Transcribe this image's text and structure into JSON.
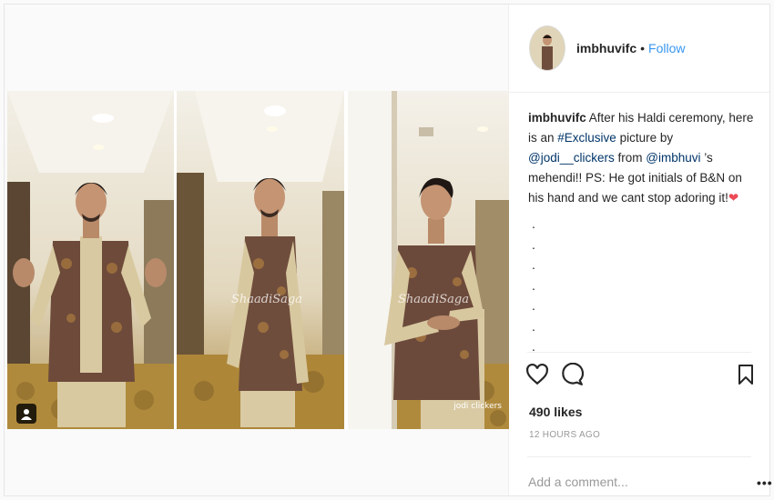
{
  "post": {
    "username": "imbhuvifc",
    "separator": "•",
    "follow_label": "Follow",
    "caption": {
      "username": "imbhuvifc",
      "text_1": " After his Haldi ceremony, here is an ",
      "hashtag": "#Exclusive",
      "text_2": " picture by ",
      "mention_1": "@jodi__clickers",
      "text_3": " from ",
      "mention_2": "@imbhuvi",
      "text_4": " ’s mehendi!! PS: He got initials of B&N on his hand and we cant stop adoring it!",
      "emoji": "❤"
    },
    "caption_dots": [
      ".",
      ".",
      ".",
      ".",
      ".",
      ".",
      "."
    ],
    "likes": "490 likes",
    "timestamp": "12 HOURS AGO",
    "comment_placeholder": "Add a comment...",
    "more_label": "•••"
  },
  "media": {
    "watermark": "ShaadiSaga",
    "credit": "jodi clickers",
    "icons": {
      "user_tag": "user-tag-icon",
      "like": "heart-icon",
      "comment": "comment-icon",
      "save": "bookmark-icon"
    }
  },
  "colors": {
    "link": "#003569",
    "follow": "#3897f0",
    "emoji": "#ed4956"
  }
}
